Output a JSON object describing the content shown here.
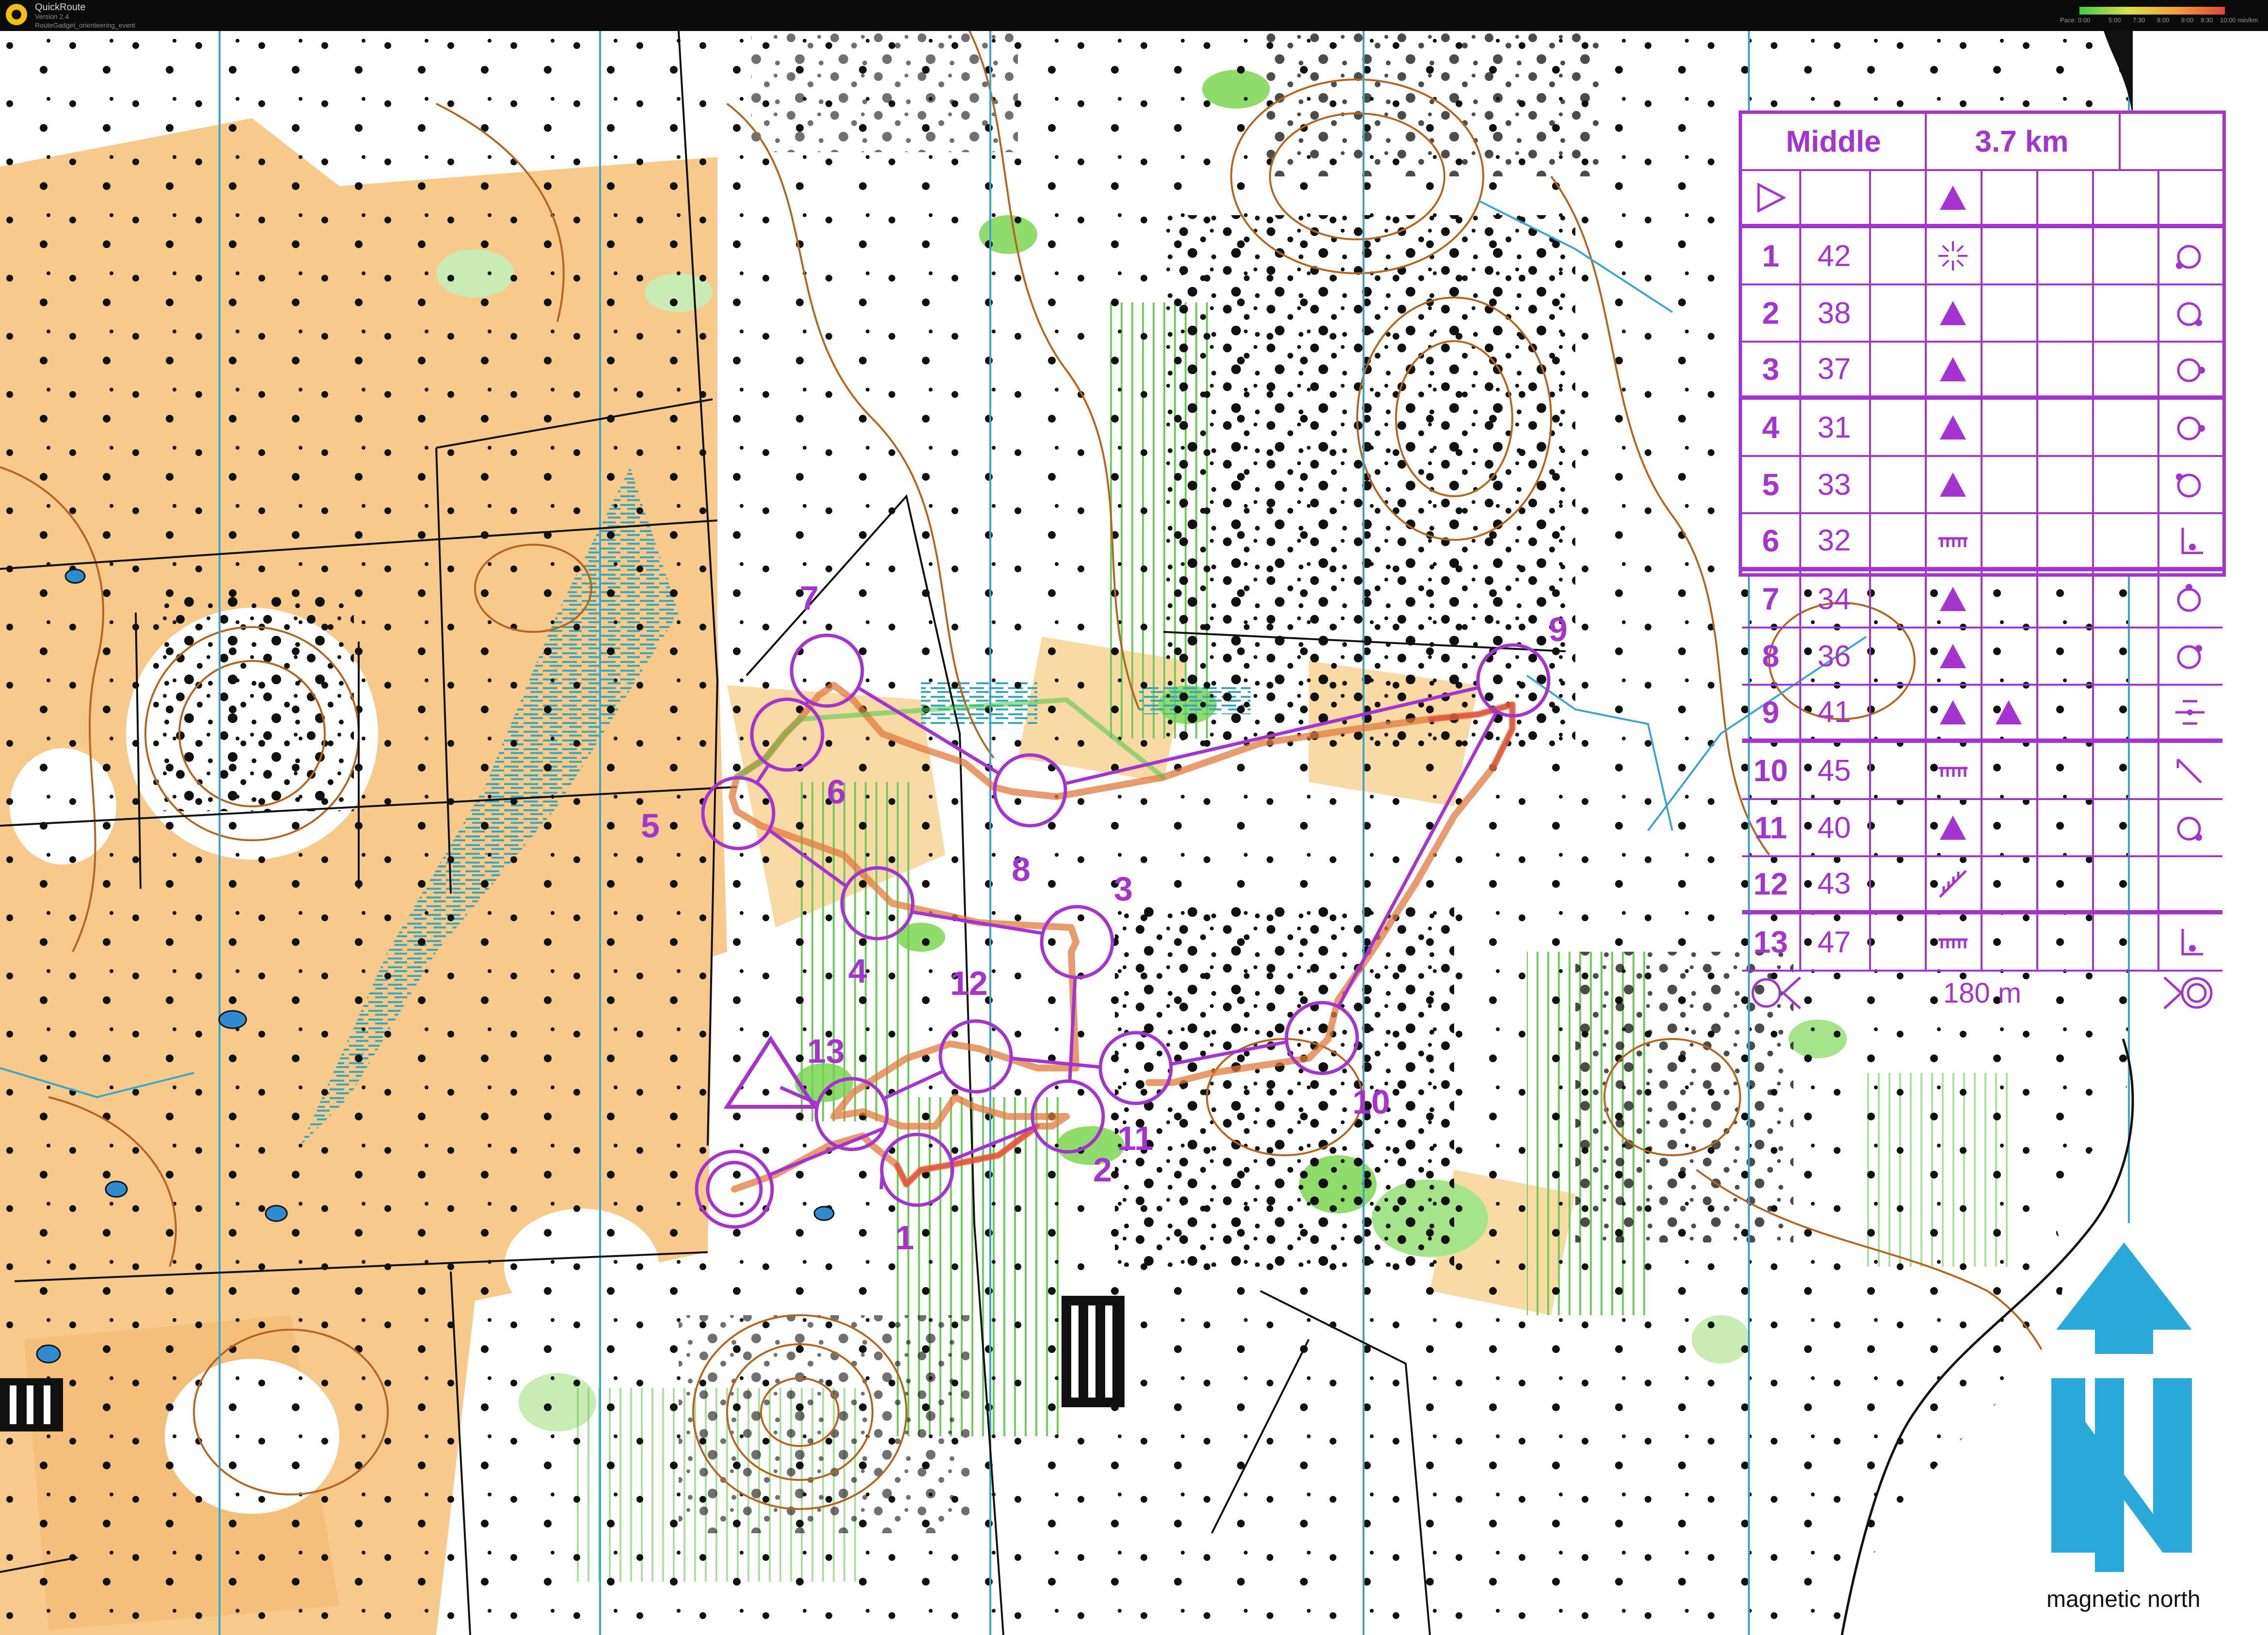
{
  "window": {
    "app_name": "QuickRoute",
    "version": "Version 2.4",
    "path": "RouteGadget_orienteering_event"
  },
  "pace_legend": {
    "labels": [
      "Pace: 0:00",
      "5:00",
      "7:30",
      "8:00",
      "9:00",
      "9:30",
      "10:00 min/km"
    ]
  },
  "colors": {
    "course": "#a533cf",
    "north_arrow": "#29a8da",
    "open_land": "#f7c98a",
    "forest_green": "#8fdc6a",
    "contour": "#b5651d",
    "route_slow": "#e0463c",
    "route_fast": "#45c84a"
  },
  "course": {
    "name": "Middle",
    "length": "3.7 km",
    "start_symbol": "triangle-icon",
    "finish_distance": "180 m",
    "controls": [
      {
        "no": "1",
        "code": "42",
        "feature": "boulder-field-icon",
        "position": "boulder-sw-icon"
      },
      {
        "no": "2",
        "code": "38",
        "feature": "boulder-icon",
        "position": "boulder-se-icon"
      },
      {
        "no": "3",
        "code": "37",
        "feature": "boulder-icon",
        "position": "boulder-e-icon"
      },
      {
        "no": "4",
        "code": "31",
        "feature": "boulder-icon",
        "position": "boulder-e-icon"
      },
      {
        "no": "5",
        "code": "33",
        "feature": "boulder-icon",
        "position": "boulder-nw-icon"
      },
      {
        "no": "6",
        "code": "32",
        "feature": "cliff-icon",
        "position": "foot-icon"
      },
      {
        "no": "7",
        "code": "34",
        "feature": "boulder-icon",
        "position": "boulder-n-icon"
      },
      {
        "no": "8",
        "code": "36",
        "feature": "boulder-icon",
        "position": "boulder-ne-icon"
      },
      {
        "no": "9",
        "code": "41",
        "feature": "boulder-icon",
        "feature2": "boulder-icon",
        "position": "between-icon"
      },
      {
        "no": "10",
        "code": "45",
        "feature": "cliff-icon",
        "position": "corner-icon"
      },
      {
        "no": "11",
        "code": "40",
        "feature": "boulder-icon",
        "position": "boulder-se-icon"
      },
      {
        "no": "12",
        "code": "43",
        "feature": "slope-icon",
        "position": ""
      },
      {
        "no": "13",
        "code": "47",
        "feature": "cliff-icon",
        "position": "foot-icon"
      }
    ]
  },
  "map_controls": [
    {
      "label": "1"
    },
    {
      "label": "2"
    },
    {
      "label": "3"
    },
    {
      "label": "4"
    },
    {
      "label": "5"
    },
    {
      "label": "6"
    },
    {
      "label": "7"
    },
    {
      "label": "8"
    },
    {
      "label": "9"
    },
    {
      "label": "10"
    },
    {
      "label": "11"
    },
    {
      "label": "12"
    },
    {
      "label": "13"
    }
  ],
  "north_arrow": {
    "letter_icon": "north-arrow-icon",
    "caption": "magnetic north"
  }
}
